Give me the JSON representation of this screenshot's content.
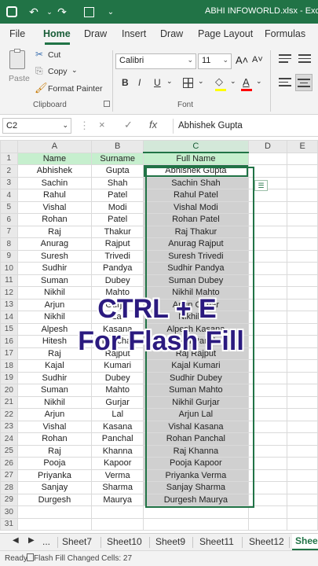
{
  "window": {
    "title": "ABHI INFOWORLD.xlsx  -  Exce"
  },
  "ribbon_tabs": [
    "File",
    "Home",
    "Draw",
    "Insert",
    "Draw",
    "Page Layout",
    "Formulas"
  ],
  "clipboard": {
    "paste_label": "Paste",
    "cut_label": "Cut",
    "copy_label": "Copy",
    "format_painter_label": "Format Painter",
    "group_label": "Clipboard"
  },
  "font": {
    "name": "Calibri",
    "size": "11",
    "grow_label": "A˄",
    "shrink_label": "A˅",
    "bold": "B",
    "italic": "I",
    "underline": "U",
    "group_label": "Font",
    "fill_color": "#ffff00",
    "font_color": "#ff0000"
  },
  "formula_bar": {
    "name_box": "C2",
    "cancel_icon": "×",
    "enter_icon": "✓",
    "fx_label": "fx",
    "formula": "Abhishek Gupta"
  },
  "columns": [
    "A",
    "B",
    "C",
    "D",
    "E"
  ],
  "rows": [
    [
      "1",
      "Name",
      "Surname",
      "Full Name"
    ],
    [
      "2",
      "Abhishek",
      "Gupta",
      "Abhishek Gupta"
    ],
    [
      "3",
      "Sachin",
      "Shah",
      "Sachin Shah"
    ],
    [
      "4",
      "Rahul",
      "Patel",
      "Rahul Patel"
    ],
    [
      "5",
      "Vishal",
      "Modi",
      "Vishal Modi"
    ],
    [
      "6",
      "Rohan",
      "Patel",
      "Rohan Patel"
    ],
    [
      "7",
      "Raj",
      "Thakur",
      "Raj Thakur"
    ],
    [
      "8",
      "Anurag",
      "Rajput",
      "Anurag Rajput"
    ],
    [
      "9",
      "Suresh",
      "Trivedi",
      "Suresh Trivedi"
    ],
    [
      "10",
      "Sudhir",
      "Pandya",
      "Sudhir Pandya"
    ],
    [
      "11",
      "Suman",
      "Dubey",
      "Suman Dubey"
    ],
    [
      "12",
      "Nikhil",
      "Mahto",
      "Nikhil Mahto"
    ],
    [
      "13",
      "Arjun",
      "Gurjar",
      "Arjun Gurjar"
    ],
    [
      "14",
      "Nikhil",
      "Lal",
      "Nikhil Lal"
    ],
    [
      "15",
      "Alpesh",
      "Kasana",
      "Alpesh Kasana"
    ],
    [
      "16",
      "Hitesh",
      "Panchal",
      "Hitesh Panchal"
    ],
    [
      "17",
      "Raj",
      "Rajput",
      "Raj Rajput"
    ],
    [
      "18",
      "Kajal",
      "Kumari",
      "Kajal Kumari"
    ],
    [
      "19",
      "Sudhir",
      "Dubey",
      "Sudhir Dubey"
    ],
    [
      "20",
      "Suman",
      "Mahto",
      "Suman Mahto"
    ],
    [
      "21",
      "Nikhil",
      "Gurjar",
      "Nikhil Gurjar"
    ],
    [
      "22",
      "Arjun",
      "Lal",
      "Arjun Lal"
    ],
    [
      "23",
      "Vishal",
      "Kasana",
      "Vishal Kasana"
    ],
    [
      "24",
      "Rohan",
      "Panchal",
      "Rohan Panchal"
    ],
    [
      "25",
      "Raj",
      "Khanna",
      "Raj Khanna"
    ],
    [
      "26",
      "Pooja",
      "Kapoor",
      "Pooja Kapoor"
    ],
    [
      "27",
      "Priyanka",
      "Verma",
      "Priyanka Verma"
    ],
    [
      "28",
      "Sanjay",
      "Sharma",
      "Sanjay Sharma"
    ],
    [
      "29",
      "Durgesh",
      "Maurya",
      "Durgesh Maurya"
    ],
    [
      "30",
      "",
      "",
      ""
    ],
    [
      "31",
      "",
      "",
      ""
    ]
  ],
  "overlay": {
    "line1": "CTRL + E",
    "line2": "For Flash Fill"
  },
  "sheet_tabs": {
    "more": "...",
    "tabs": [
      "Sheet7",
      "Sheet10",
      "Sheet9",
      "Sheet11",
      "Sheet12"
    ],
    "active": "Shee"
  },
  "status": {
    "ready": "Ready",
    "message": "Flash Fill Changed Cells: 27"
  },
  "colors": {
    "accent": "#217346",
    "header_fill": "#c6efce",
    "selection_fill": "#d0d0d0",
    "overlay_text": "#2b1a7f"
  }
}
